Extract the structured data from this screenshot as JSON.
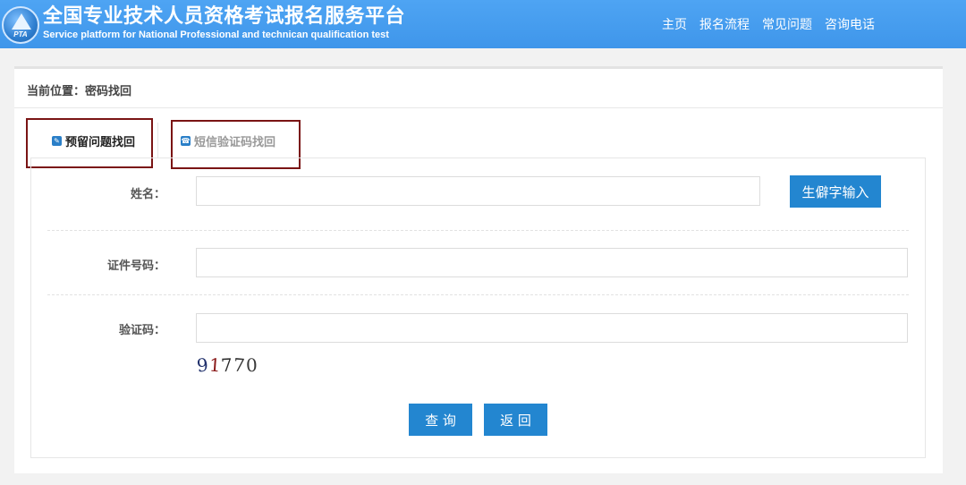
{
  "header": {
    "title_cn": "全国专业技术人员资格考试报名服务平台",
    "title_en": "Service platform for National Professional and technican qualification test",
    "logo_text": "PTA",
    "nav": [
      "主页",
      "报名流程",
      "常见问题",
      "咨询电话"
    ]
  },
  "breadcrumb": "当前位置：密码找回",
  "tabs": [
    {
      "label": "预留问题找回",
      "icon": "edit-icon"
    },
    {
      "label": "短信验证码找回",
      "icon": "phone-icon"
    }
  ],
  "form": {
    "name_label": "姓名：",
    "rare_char_button": "生僻字输入",
    "id_label": "证件号码：",
    "captcha_label": "验证码：",
    "captcha_chars": [
      "9",
      "1",
      "7",
      "7",
      "0"
    ]
  },
  "actions": {
    "query": "查 询",
    "back": "返 回"
  },
  "colors": {
    "header_bg": "#4aa0f0",
    "button_bg": "#2386d0",
    "highlight_box": "#7a1414"
  }
}
